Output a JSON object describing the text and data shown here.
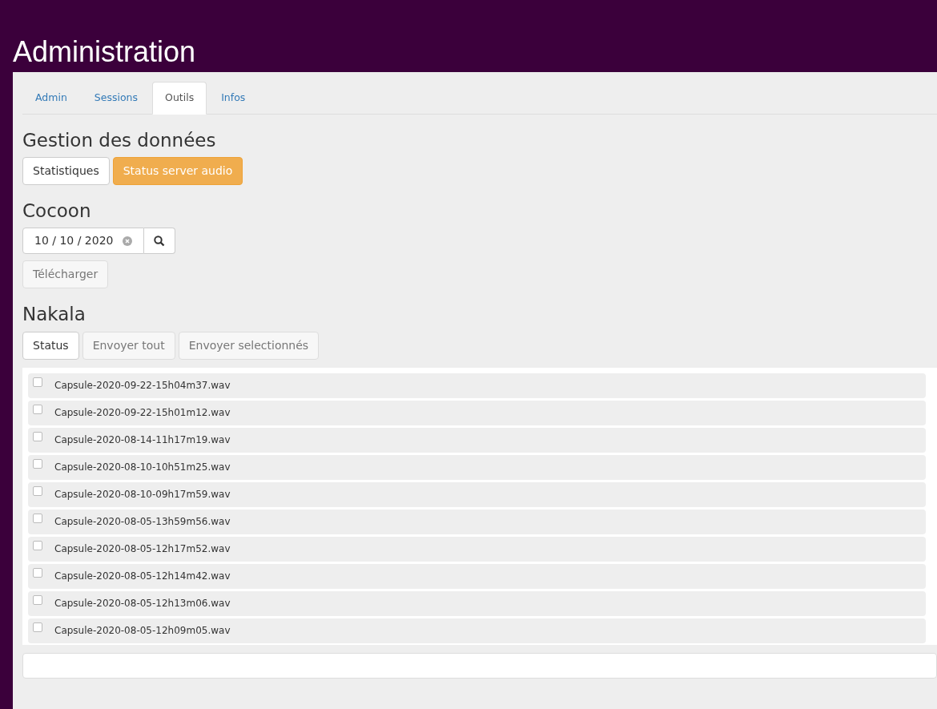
{
  "page_title": "Administration",
  "tabs": [
    {
      "label": "Admin",
      "selected": false
    },
    {
      "label": "Sessions",
      "selected": false
    },
    {
      "label": "Outils",
      "selected": true
    },
    {
      "label": "Infos",
      "selected": false
    }
  ],
  "sections": [
    {
      "heading": "Gestion des données",
      "buttons": [
        {
          "label": "Statistiques",
          "kind": "default",
          "disabled": false
        },
        {
          "label": "Status server audio",
          "kind": "warning",
          "disabled": false
        }
      ]
    },
    {
      "heading": "Cocoon",
      "date_field": {
        "value": "10 / 10 / 2020"
      },
      "buttons": [
        {
          "label": "Télécharger",
          "kind": "default",
          "disabled": true
        }
      ]
    },
    {
      "heading": "Nakala",
      "buttons": [
        {
          "label": "Status",
          "kind": "default",
          "disabled": false
        },
        {
          "label": "Envoyer tout",
          "kind": "default",
          "disabled": true
        },
        {
          "label": "Envoyer selectionnés",
          "kind": "default",
          "disabled": true
        }
      ]
    }
  ],
  "files": [
    {
      "name": "Capsule-2020-09-22-15h04m37.wav",
      "checked": false
    },
    {
      "name": "Capsule-2020-09-22-15h01m12.wav",
      "checked": false
    },
    {
      "name": "Capsule-2020-08-14-11h17m19.wav",
      "checked": false
    },
    {
      "name": "Capsule-2020-08-10-10h51m25.wav",
      "checked": false
    },
    {
      "name": "Capsule-2020-08-10-09h17m59.wav",
      "checked": false
    },
    {
      "name": "Capsule-2020-08-05-13h59m56.wav",
      "checked": false
    },
    {
      "name": "Capsule-2020-08-05-12h17m52.wav",
      "checked": false
    },
    {
      "name": "Capsule-2020-08-05-12h14m42.wav",
      "checked": false
    },
    {
      "name": "Capsule-2020-08-05-12h13m06.wav",
      "checked": false
    },
    {
      "name": "Capsule-2020-08-05-12h09m05.wav",
      "checked": false
    }
  ]
}
